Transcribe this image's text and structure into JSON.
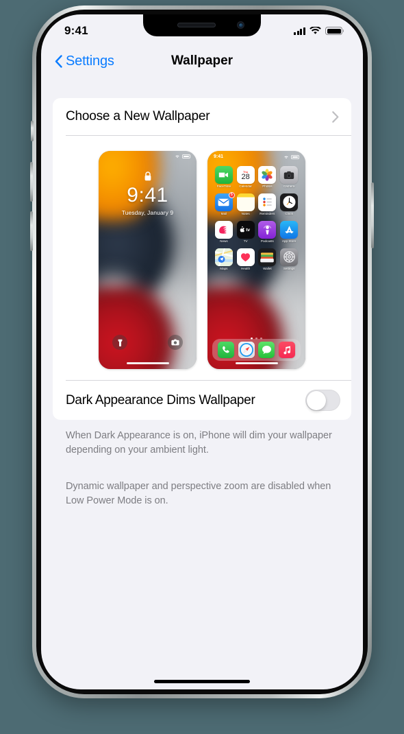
{
  "statusbar": {
    "time": "9:41",
    "signal_icon": "cellular-signal-icon",
    "wifi_icon": "wifi-icon",
    "battery_icon": "battery-full-icon"
  },
  "navbar": {
    "back_label": "Settings",
    "back_icon": "chevron-left-icon",
    "title": "Wallpaper"
  },
  "main": {
    "choose_row": {
      "label": "Choose a New Wallpaper",
      "chevron_icon": "chevron-right-icon"
    },
    "toggle_row": {
      "label": "Dark Appearance Dims Wallpaper",
      "state": "off"
    },
    "footnotes": [
      "When Dark Appearance is on, iPhone will dim your wallpaper depending on your ambient light.",
      "Dynamic wallpaper and perspective zoom are disabled when Low Power Mode is on."
    ]
  },
  "lock_preview": {
    "name": "lock-screen-preview",
    "lock_icon": "lock-closed-icon",
    "time": "9:41",
    "date": "Tuesday, January 9",
    "wifi_icon": "wifi-icon",
    "battery_icon": "battery-icon",
    "flashlight_icon": "flashlight-icon",
    "camera_icon": "camera-icon"
  },
  "home_preview": {
    "name": "home-screen-preview",
    "time": "9:41",
    "wifi_icon": "wifi-icon",
    "battery_icon": "battery-icon",
    "calendar_weekday": "Thu",
    "calendar_day": "28",
    "mail_badge": "5",
    "page_dots": 3,
    "active_dot": 1,
    "apps": [
      {
        "label": "FaceTime",
        "icon": "facetime-icon"
      },
      {
        "label": "Calendar",
        "icon": "calendar-icon"
      },
      {
        "label": "Photos",
        "icon": "photos-icon"
      },
      {
        "label": "Camera",
        "icon": "camera-icon"
      },
      {
        "label": "Mail",
        "icon": "mail-icon"
      },
      {
        "label": "Notes",
        "icon": "notes-icon"
      },
      {
        "label": "Reminders",
        "icon": "reminders-icon"
      },
      {
        "label": "Clock",
        "icon": "clock-icon"
      },
      {
        "label": "News",
        "icon": "news-icon"
      },
      {
        "label": "TV",
        "icon": "tv-icon"
      },
      {
        "label": "Podcasts",
        "icon": "podcasts-icon"
      },
      {
        "label": "App Store",
        "icon": "app-store-icon"
      },
      {
        "label": "Maps",
        "icon": "maps-icon"
      },
      {
        "label": "Health",
        "icon": "health-icon"
      },
      {
        "label": "Wallet",
        "icon": "wallet-icon"
      },
      {
        "label": "Settings",
        "icon": "settings-icon"
      }
    ],
    "dock": [
      {
        "label": "Phone",
        "icon": "phone-icon"
      },
      {
        "label": "Safari",
        "icon": "safari-icon"
      },
      {
        "label": "Messages",
        "icon": "messages-icon"
      },
      {
        "label": "Music",
        "icon": "music-icon"
      }
    ]
  },
  "colors": {
    "page_background": "#4d6b73",
    "accent_blue": "#0a7cff",
    "grouped_background": "#f2f2f7",
    "card": "#ffffff",
    "footnote_text": "#7d7d82",
    "wallpaper_orange": "#f59000",
    "wallpaper_navy": "#1f2937",
    "wallpaper_red": "#a8121c"
  }
}
